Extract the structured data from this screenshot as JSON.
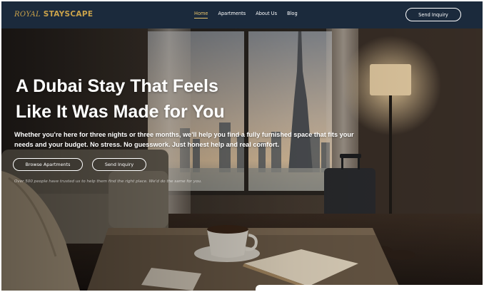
{
  "brand": {
    "royal": "ROYAL",
    "name": "STAYSCAPE"
  },
  "nav": {
    "items": [
      "Home",
      "Apartments",
      "About Us",
      "Blog"
    ],
    "cta": "Send Inquiry"
  },
  "hero": {
    "title_line1": "A Dubai Stay That Feels",
    "title_line2": "Like It Was Made for You",
    "subtitle": "Whether you're here for three nights or three months, we'll help you find a fully furnished space that fits your needs and your budget. No stress. No guesswork. Just honest help and real comfort.",
    "browse_button": "Browse Apartments",
    "inquiry_button": "Send Inquiry",
    "trust_line": "Over 500 people have trusted us to help them find the right place. We'd do the same for you."
  },
  "colors": {
    "nav_bg": "#1b2a3c",
    "accent_gold": "#c9a24a",
    "active_link": "#e8c46b"
  }
}
